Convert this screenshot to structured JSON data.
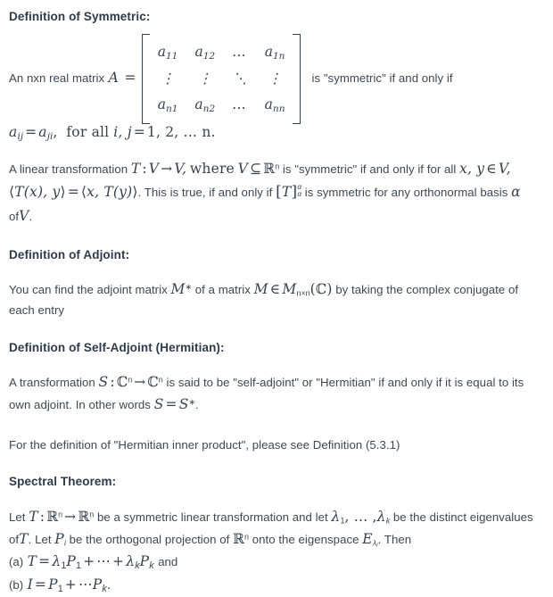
{
  "document": {
    "type": "math-notes",
    "background_color": "#ffffff",
    "text_color": "#3d4852",
    "heading_color": "#2f3a4a",
    "math_color": "#37424f"
  },
  "sections": {
    "symmetric": {
      "heading": "Definition of Symmetric:",
      "lead_text": "An nxn real matrix",
      "matrix_var": "A",
      "equals": "=",
      "matrix": {
        "rows": [
          [
            "a",
            "a",
            "…",
            "a"
          ],
          [
            "⋮",
            "⋮",
            "⋱",
            "⋮"
          ],
          [
            "a",
            "a",
            "…",
            "a"
          ]
        ],
        "entries": {
          "r1c1": "a",
          "r1c1_sub": "11",
          "r1c2": "a",
          "r1c2_sub": "12",
          "r1c3": "…",
          "r1c4": "a",
          "r1c4_sub": "1n",
          "r2c1": "⋮",
          "r2c2": "⋮",
          "r2c3": "⋱",
          "r2c4": "⋮",
          "r3c1": "a",
          "r3c1_sub": "n1",
          "r3c2": "a",
          "r3c2_sub": "n2",
          "r3c3": "…",
          "r3c4": "a",
          "r3c4_sub": "nn"
        }
      },
      "trail_text": "is \"symmetric\" if and only if",
      "condition": {
        "lhs_var": "a",
        "lhs_sub": "ij",
        "eq": "=",
        "rhs_var": "a",
        "rhs_sub": "ji",
        "comma": ",",
        "for_all": "for all",
        "indices": "i, j",
        "eq2": "=",
        "values": "1, 2, … n."
      },
      "paragraph": {
        "p1": "A linear transformation",
        "T": "T",
        "colon": ":",
        "V1": "V",
        "arrow": "→",
        "V2": "V,",
        "where": "where",
        "V3": "V",
        "subset": "⊆",
        "R": "ℝ",
        "R_sup": "n",
        "p2": "is \"symmetric\" if and only if for all",
        "xy": "x, y",
        "in": "∈",
        "V4": "V,",
        "inner1_open": "⟨",
        "inner1": "T(x), y",
        "inner1_close": "⟩",
        "eq3": "=",
        "inner2_open": "⟨",
        "inner2": "x, T(y)",
        "inner2_close": "⟩",
        "period": ".",
        "p3": "This is true, if and only if",
        "bracket_open": "[",
        "T2": "T",
        "bracket_close": "]",
        "alpha_sup": "α",
        "alpha_sub": "α",
        "p4": "is symmetric for any orthonormal basis",
        "alpha": "α",
        "of": "of",
        "V5": "V",
        "period2": "."
      }
    },
    "adjoint": {
      "heading": "Definition of Adjoint:",
      "p1": "You can find the adjoint matrix",
      "M_star": "M",
      "star": "∗",
      "p2": "of a matrix",
      "M": "M",
      "in": "∈",
      "M_cal": "M",
      "M_sub": "n×n",
      "paren_open": "(",
      "C": "ℂ",
      "paren_close": ")",
      "p3": "by taking the complex conjugate of each entry"
    },
    "self_adjoint": {
      "heading": "Definition of Self-Adjoint (Hermitian):",
      "p1": "A transformation",
      "S": "S",
      "colon": ":",
      "C1": "ℂ",
      "C1_sup": "n",
      "arrow": "→",
      "C2": "ℂ",
      "C2_sup": "n",
      "p2": "is said to be \"self-adjoint\" or \"Hermitian\" if and only if it is equal to its own adjoint. In other words",
      "S_eq": "S",
      "eq": "=",
      "S_star": "S",
      "star": "∗",
      "period": "."
    },
    "hermitian_note": {
      "text": "For the definition of \"Hermitian inner product\", please see Definition (5.3.1)"
    },
    "spectral": {
      "heading": "Spectral Theorem:",
      "p1": "Let",
      "T": "T",
      "colon": ":",
      "R1": "ℝ",
      "R1_sup": "n",
      "arrow": "→",
      "R2": "ℝ",
      "R2_sup": "n",
      "p2": "be a symmetric linear transformation and let",
      "lambda1": "λ",
      "lambda1_sub": "1",
      "ldots": ", … ,",
      "lambdak": "λ",
      "lambdak_sub": "k",
      "p3": "be the distinct eigenvalues of",
      "T2": "T",
      "period1": ".",
      "p4": "Let",
      "P": "P",
      "P_sub": "i",
      "p5": "be the orthogonal projection of",
      "R3": "ℝ",
      "R3_sup": "n",
      "p6": "onto the eigenspace",
      "E": "E",
      "E_sub": "λ",
      "E_subsub": "i",
      "period2": ".",
      "p7": "Then",
      "items": [
        {
          "label": "(a)",
          "lhs": "T",
          "eq": "=",
          "term1_lambda": "λ",
          "term1_lambda_sub": "1",
          "term1_P": "P",
          "term1_P_sub": "1",
          "plus1": "+",
          "cdots": "⋯",
          "plus2": "+",
          "term2_lambda": "λ",
          "term2_lambda_sub": "k",
          "term2_P": "P",
          "term2_P_sub": "k",
          "trailing": "and"
        },
        {
          "label": "(b)",
          "lhs": "I",
          "eq": "=",
          "term1_P": "P",
          "term1_P_sub": "1",
          "plus1": "+",
          "cdots": "⋯",
          "term2_P": "P",
          "term2_P_sub": "k",
          "period": ".",
          "trailing": ""
        }
      ]
    }
  }
}
